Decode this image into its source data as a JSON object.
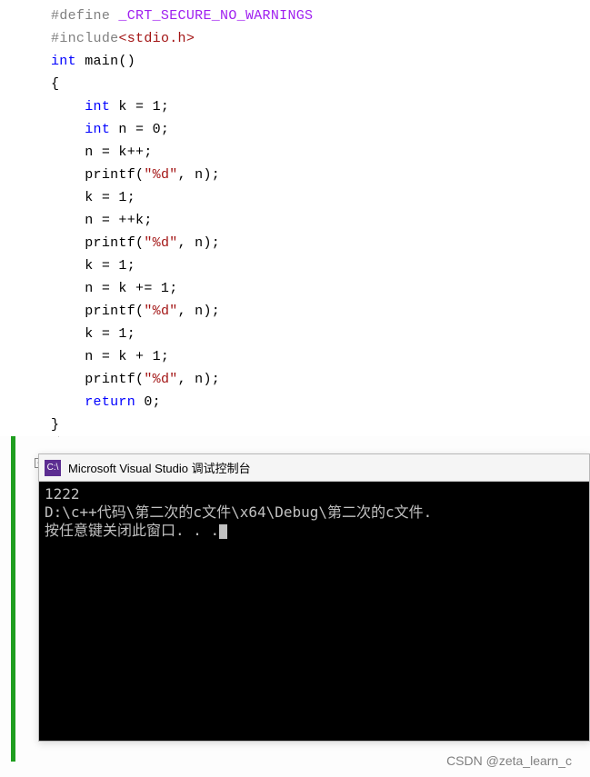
{
  "code": {
    "line1_hash": "#",
    "line1_define": "define",
    "line1_macro": " _CRT_SECURE_NO_WARNINGS",
    "line2_hash": "#",
    "line2_include": "include",
    "line2_lt": "<",
    "line2_header": "stdio.h",
    "line2_gt": ">",
    "line3_int": "int",
    "line3_main": " main",
    "line3_parens": "()",
    "line4": "{",
    "line5_int": "int",
    "line5_rest": " k = 1;",
    "line6_int": "int",
    "line6_rest": " n = 0;",
    "line7": "n = k++;",
    "line8_printf": "printf",
    "line8_open": "(",
    "line8_str": "\"%d\"",
    "line8_close": ", n);",
    "line9": "k = 1;",
    "line10": "n = ++k;",
    "line11_printf": "printf",
    "line11_open": "(",
    "line11_str": "\"%d\"",
    "line11_close": ", n);",
    "line12": "k = 1;",
    "line13": "n = k += 1;",
    "line14_printf": "printf",
    "line14_open": "(",
    "line14_str": "\"%d\"",
    "line14_close": ", n);",
    "line15": "k = 1;",
    "line16": "n = k + 1;",
    "line17_printf": "printf",
    "line17_open": "(",
    "line17_str": "\"%d\"",
    "line17_close": ", n);",
    "line18_return": "return",
    "line18_rest": " 0;",
    "line19": "}"
  },
  "console": {
    "icon_text": "C:\\",
    "title": "Microsoft Visual Studio 调试控制台",
    "out1": "1222",
    "out2": "D:\\c++代码\\第二次的c文件\\x64\\Debug\\第二次的c文件.",
    "out3": "按任意键关闭此窗口. . ."
  },
  "watermark": "CSDN @zeta_learn_c",
  "collapse_glyph": "−"
}
